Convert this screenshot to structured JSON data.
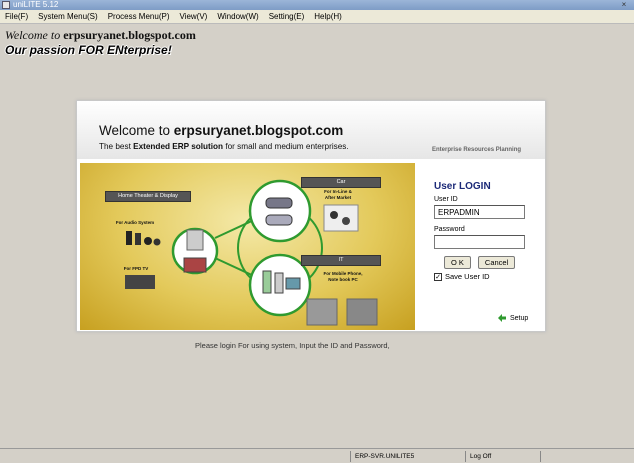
{
  "window": {
    "title": "uniLITE 5.12",
    "close_glyph": "×"
  },
  "menu": [
    "File(F)",
    "System Menu(S)",
    "Process Menu(P)",
    "View(V)",
    "Window(W)",
    "Setting(E)",
    "Help(H)"
  ],
  "banner": {
    "line1_prefix": "Welcome to ",
    "line1_site": "erpsuryanet.blogspot.com",
    "line2": "Our passion FOR ENterprise!"
  },
  "card": {
    "title_prefix": "Welcome to ",
    "title_site": "erpsuryanet.blogspot.com",
    "subtitle_prefix": "The best ",
    "subtitle_bold": "Extended ERP solution",
    "subtitle_suffix": " for small and medium enterprises.",
    "tag": "Enterprise Resources Planning"
  },
  "promo": {
    "home_theater": "Home Theater & Display",
    "audio": "For Audio System",
    "fpd": "For FPD TV",
    "car": "Car",
    "car_sub": "For In-Line & After Market",
    "it": "IT",
    "it_sub": "For Mobile Phone, Note book PC"
  },
  "login": {
    "title": "User LOGIN",
    "user_label": "User ID",
    "user_value": "ERPADMIN",
    "password_label": "Password",
    "password_value": "",
    "ok": "O K",
    "cancel": "Cancel",
    "save_label": "Save User ID",
    "check_glyph": "✓",
    "setup": "Setup"
  },
  "hint": "Please login For using system, Input the ID and Password,",
  "status": {
    "server": "ERP-SVR.UNILITE5",
    "log": "Log Off"
  },
  "colors": {
    "login_title": "#1c2a78",
    "promo_gold": "#e3c95a",
    "circle_green": "#2f9a2f"
  }
}
